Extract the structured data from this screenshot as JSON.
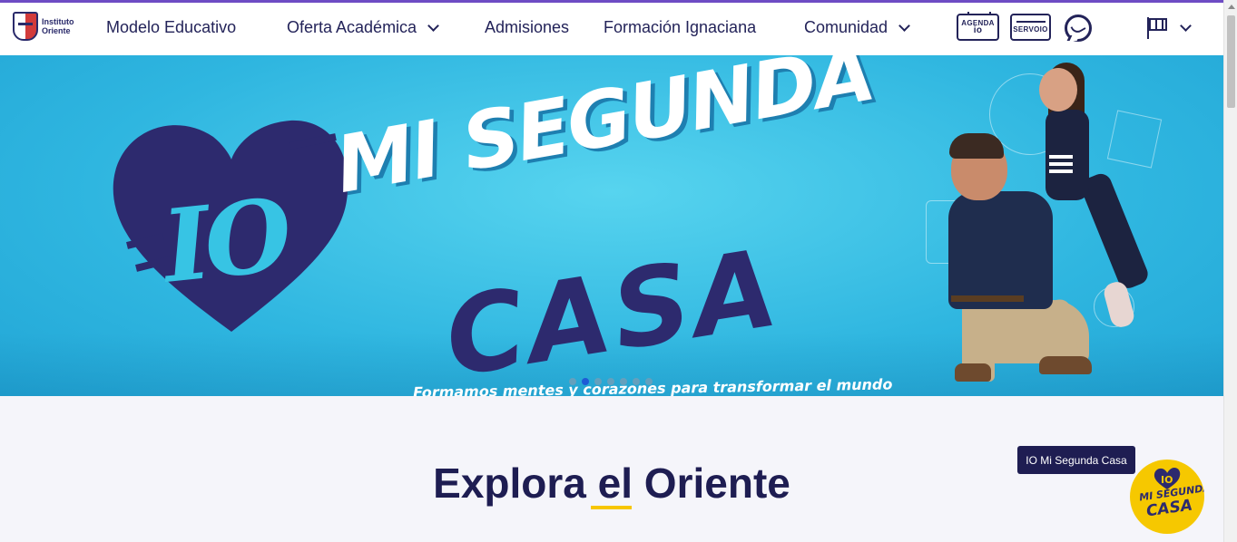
{
  "header": {
    "logo": {
      "line1": "Instituto",
      "line2": "Oriente"
    },
    "nav": [
      {
        "label": "Modelo Educativo",
        "has_dropdown": false
      },
      {
        "label": "Oferta Académica",
        "has_dropdown": true
      },
      {
        "label": "Admisiones",
        "has_dropdown": false
      },
      {
        "label": "Formación Ignaciana",
        "has_dropdown": false
      },
      {
        "label": "Comunidad",
        "has_dropdown": true
      }
    ],
    "icons": {
      "agenda": {
        "line1": "AGENDA",
        "line2": "io"
      },
      "servo": {
        "label": "SERVOIO"
      },
      "whatsapp": "whatsapp-icon",
      "language": "flag-icon"
    }
  },
  "hero": {
    "heart_text": "IO",
    "headline_top": "MI SEGUNDA",
    "headline_bottom": "CASA",
    "tagline": "Formamos mentes y corazones para transformar el mundo",
    "slides_total": 7,
    "active_slide": 2
  },
  "section": {
    "title_part1": "Explora ",
    "title_part2": "el",
    "title_part3": " Oriente"
  },
  "floating": {
    "tooltip": "IO Mi Segunda Casa",
    "badge_line1": "MI SEGUNDA",
    "badge_line2": "CASA",
    "badge_io": "IO"
  },
  "colors": {
    "brand_navy": "#232359",
    "accent_purple": "#6e4cc4",
    "hero_blue": "#2fb6e0",
    "yellow": "#f6c800"
  }
}
